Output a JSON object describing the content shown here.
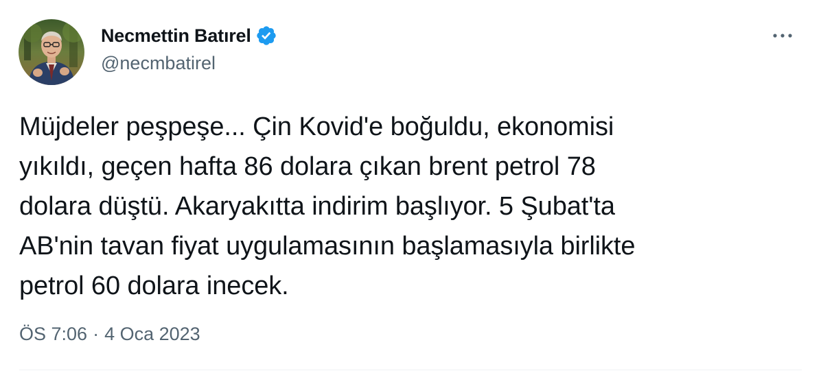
{
  "author": {
    "display_name": "Necmettin Batırel",
    "handle": "@necmbatirel",
    "verified_color": "#1d9bf0"
  },
  "tweet": {
    "lines": [
      "Müjdeler peşpeşe... Çin Kovid'e boğuldu, ekonomisi",
      "yıkıldı, geçen hafta 86 dolara çıkan brent petrol 78",
      "dolara düştü. Akaryakıtta indirim başlıyor. 5 Şubat'ta",
      "AB'nin tavan fiyat uygulamasının başlamasıyla birlikte",
      "petrol 60 dolara inecek."
    ],
    "time": "ÖS 7:06",
    "separator": "·",
    "date": "4 Oca 2023"
  },
  "icons": {
    "verified": "verified-badge-icon",
    "more": "more-horizontal-icon"
  },
  "colors": {
    "text_primary": "#0f1419",
    "text_secondary": "#536471",
    "accent": "#1d9bf0"
  }
}
